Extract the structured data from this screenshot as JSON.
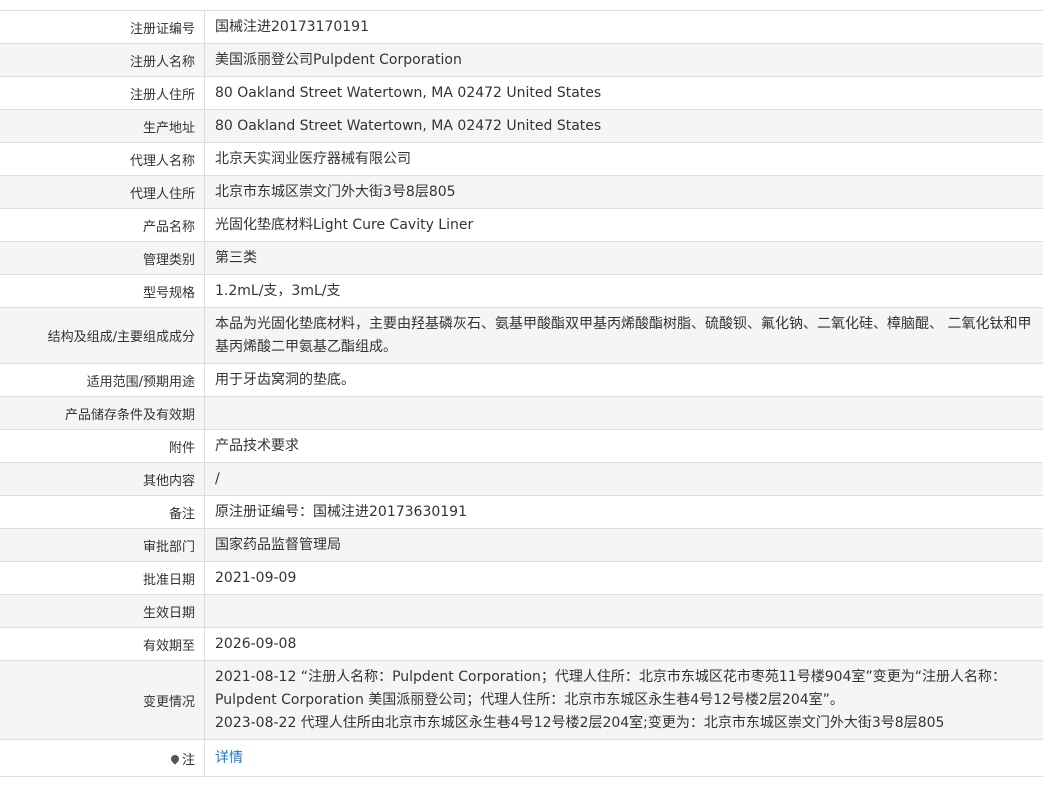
{
  "rows": [
    {
      "label": "注册证编号",
      "value": "国械注进20173170191"
    },
    {
      "label": "注册人名称",
      "value": "美国派丽登公司Pulpdent Corporation"
    },
    {
      "label": "注册人住所",
      "value": "80 Oakland Street Watertown, MA 02472 United States"
    },
    {
      "label": "生产地址",
      "value": "80 Oakland Street Watertown, MA 02472 United States"
    },
    {
      "label": "代理人名称",
      "value": "北京天实润业医疗器械有限公司"
    },
    {
      "label": "代理人住所",
      "value": "北京市东城区崇文门外大街3号8层805"
    },
    {
      "label": "产品名称",
      "value": "光固化垫底材料Light Cure Cavity Liner"
    },
    {
      "label": "管理类别",
      "value": "第三类"
    },
    {
      "label": "型号规格",
      "value": "1.2mL/支，3mL/支"
    },
    {
      "label": "结构及组成/主要组成成分",
      "value": "本品为光固化垫底材料，主要由羟基磷灰石、氨基甲酸酯双甲基丙烯酸酯树脂、硫酸钡、氟化钠、二氧化硅、樟脑醌、 二氧化钛和甲基丙烯酸二甲氨基乙酯组成。"
    },
    {
      "label": "适用范围/预期用途",
      "value": "用于牙齿窝洞的垫底。"
    },
    {
      "label": "产品储存条件及有效期",
      "value": ""
    },
    {
      "label": "附件",
      "value": "产品技术要求"
    },
    {
      "label": "其他内容",
      "value": "/"
    },
    {
      "label": "备注",
      "value": "原注册证编号：国械注进20173630191"
    },
    {
      "label": "审批部门",
      "value": "国家药品监督管理局"
    },
    {
      "label": "批准日期",
      "value": "2021-09-09"
    },
    {
      "label": "生效日期",
      "value": ""
    },
    {
      "label": "有效期至",
      "value": "2026-09-08"
    }
  ],
  "changes": {
    "label": "变更情况",
    "line1": "2021-08-12 “注册人名称：Pulpdent Corporation；代理人住所：北京市东城区花市枣苑11号楼904室”变更为“注册人名称：Pulpdent Corporation 美国派丽登公司；代理人住所：北京市东城区永生巷4号12号楼2层204室”。",
    "line2": "2023-08-22 代理人住所由北京市东城区永生巷4号12号楼2层204室;变更为：北京市东城区崇文门外大街3号8层805"
  },
  "note": {
    "label": "注",
    "icon": "location-pin-icon",
    "link_text": "详情"
  }
}
